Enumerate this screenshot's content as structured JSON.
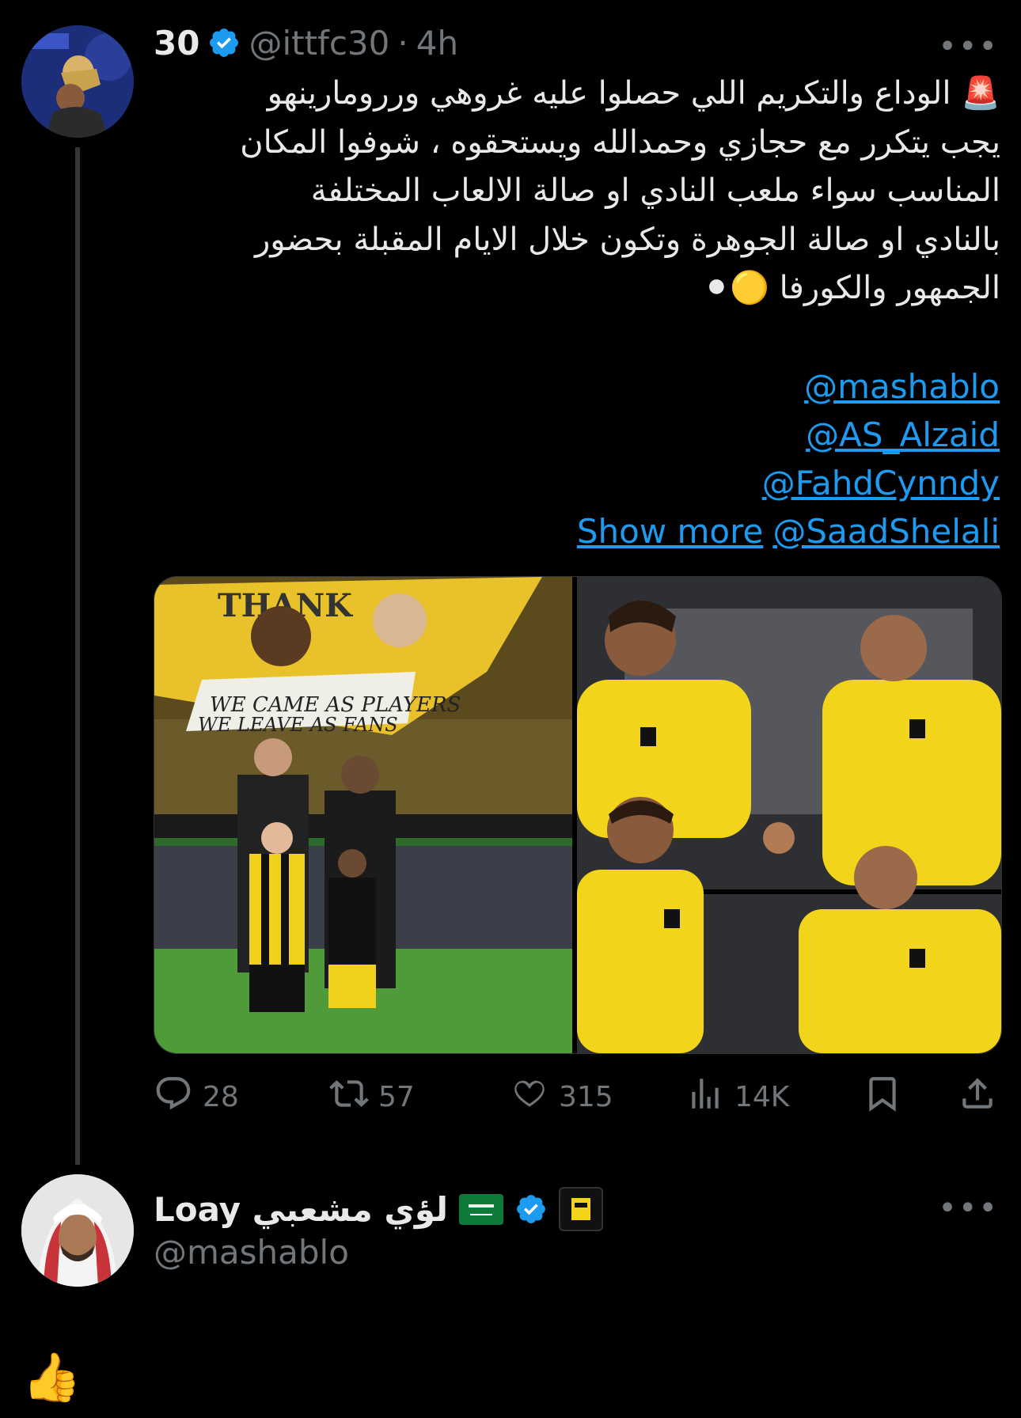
{
  "tweet": {
    "author_name": "30",
    "author_handle": "@ittfc30",
    "separator": "·",
    "time": "4h",
    "more_label": "•••",
    "lines": [
      "🚨 الوداع والتكريم اللي حصلوا عليه غروهي وررومارينهو",
      "يجب يتكرر مع حجازي وحمدالله ويستحقوه ، شوفوا المكان",
      "المناسب سواء ملعب النادي او صالة الالعاب المختلفة",
      "بالنادي او صالة الجوهرة وتكون خلال الايام المقبلة بحضور",
      "الجمهور والكورفا 🟡⚫"
    ],
    "mentions": [
      "@mashablo",
      "@AS_Alzaid",
      "@FahdCynndy"
    ],
    "show_more": "Show more",
    "last_mention": "@SaadShelali",
    "stats": {
      "replies": "28",
      "retweets": "57",
      "likes": "315",
      "views": "14K"
    },
    "banner_text": [
      "THANK",
      "WE CAME AS PLAYERS",
      "WE LEAVE AS FANS"
    ]
  },
  "reply": {
    "author_name": "Loay لؤي مشعبي",
    "flag_icon": "saudi-flag",
    "author_handle": "@mashablo",
    "more_label": "•••",
    "text": "👍"
  },
  "colors": {
    "background": "#000000",
    "link": "#1d9bf0",
    "muted": "#71767b",
    "verified": "#1d9bf0",
    "jersey_yellow": "#f2d41b"
  }
}
